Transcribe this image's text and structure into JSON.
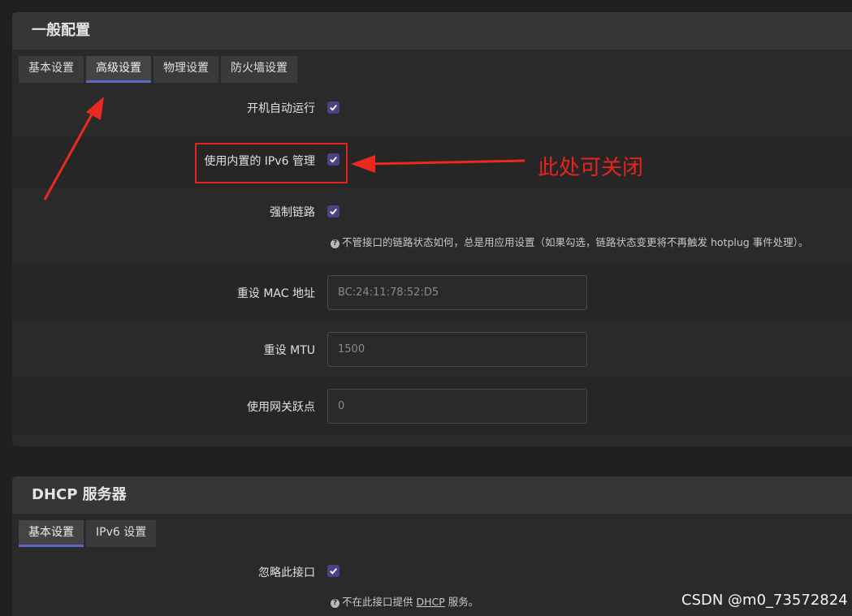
{
  "general": {
    "title": "一般配置",
    "tabs": [
      {
        "label": "基本设置",
        "active": false
      },
      {
        "label": "高级设置",
        "active": true
      },
      {
        "label": "物理设置",
        "active": false
      },
      {
        "label": "防火墙设置",
        "active": false
      }
    ],
    "rows": {
      "auto_start": {
        "label": "开机自动运行",
        "checked": true
      },
      "builtin_ipv6": {
        "label": "使用内置的 IPv6 管理",
        "checked": true
      },
      "force_link": {
        "label": "强制链路",
        "checked": true,
        "help": "不管接口的链路状态如何，总是用应用设置（如果勾选，链路状态变更将不再触发 hotplug 事件处理）。"
      },
      "mac": {
        "label": "重设 MAC 地址",
        "placeholder": "BC:24:11:78:52:D5"
      },
      "mtu": {
        "label": "重设 MTU",
        "placeholder": "1500"
      },
      "metric": {
        "label": "使用网关跃点",
        "placeholder": "0"
      }
    }
  },
  "dhcp": {
    "title": "DHCP 服务器",
    "tabs": [
      {
        "label": "基本设置",
        "active": true
      },
      {
        "label": "IPv6 设置",
        "active": false
      }
    ],
    "ignore": {
      "label": "忽略此接口",
      "checked": true,
      "help_prefix": "不在此接口提供 ",
      "help_link": "DHCP",
      "help_suffix": " 服务。"
    }
  },
  "annotation": {
    "text": "此处可关闭",
    "color": "#e8231f"
  },
  "watermark": "CSDN @m0_73572824",
  "colors": {
    "accent": "#5b67c6",
    "checkbox": "#4a4384",
    "annotation": "#e52222"
  }
}
